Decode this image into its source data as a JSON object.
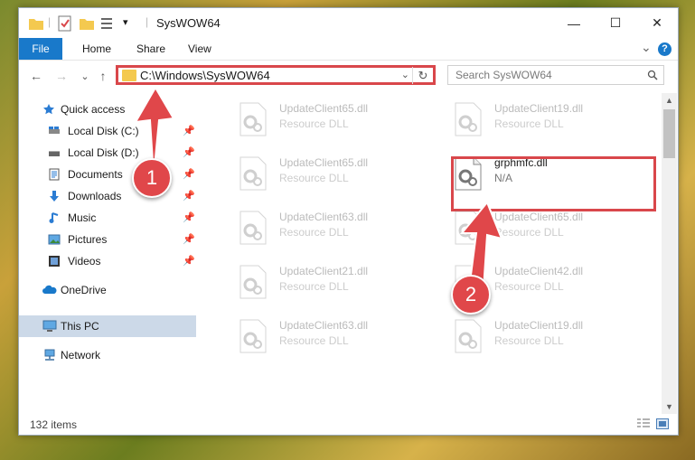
{
  "titlebar": {
    "title": "SysWOW64",
    "minimize_glyph": "—",
    "maximize_glyph": "☐",
    "close_glyph": "✕",
    "dropdown_glyph": "▾"
  },
  "ribbon": {
    "tabs": [
      "File",
      "Home",
      "Share",
      "View"
    ],
    "collapse_glyph": "⌄",
    "help_glyph": "?"
  },
  "address": {
    "back_glyph": "←",
    "forward_glyph": "→",
    "recent_glyph": "⌄",
    "up_glyph": "↑",
    "path": "C:\\Windows\\SysWOW64",
    "dropdown_glyph": "⌄",
    "refresh_glyph": "↻"
  },
  "search": {
    "placeholder": "Search SysWOW64"
  },
  "sidebar": {
    "items": [
      {
        "label": "Quick access",
        "icon": "star-icon",
        "pinned": false
      },
      {
        "label": "Local Disk (C:)",
        "icon": "drive-icon",
        "pinned": true
      },
      {
        "label": "Local Disk (D:)",
        "icon": "drive-icon",
        "pinned": true
      },
      {
        "label": "Documents",
        "icon": "documents-icon",
        "pinned": true
      },
      {
        "label": "Downloads",
        "icon": "download-icon",
        "pinned": true
      },
      {
        "label": "Music",
        "icon": "music-icon",
        "pinned": true
      },
      {
        "label": "Pictures",
        "icon": "pictures-icon",
        "pinned": true
      },
      {
        "label": "Videos",
        "icon": "videos-icon",
        "pinned": true
      },
      {
        "label": "OneDrive",
        "icon": "cloud-icon",
        "pinned": false
      },
      {
        "label": "This PC",
        "icon": "computer-icon",
        "pinned": false,
        "selected": true
      },
      {
        "label": "Network",
        "icon": "network-icon",
        "pinned": false
      }
    ],
    "pin_glyph": "📌"
  },
  "files": [
    {
      "name": "UpdateClient65.dll",
      "desc": "Resource DLL"
    },
    {
      "name": "UpdateClient19.dll",
      "desc": "Resource DLL"
    },
    {
      "name": "UpdateClient65.dll",
      "desc": "Resource DLL"
    },
    {
      "name": "grphmfc.dll",
      "desc": "N/A",
      "highlight": true
    },
    {
      "name": "UpdateClient63.dll",
      "desc": "Resource DLL"
    },
    {
      "name": "UpdateClient65.dll",
      "desc": "Resource DLL"
    },
    {
      "name": "UpdateClient21.dll",
      "desc": "Resource DLL"
    },
    {
      "name": "UpdateClient42.dll",
      "desc": "Resource DLL"
    },
    {
      "name": "UpdateClient63.dll",
      "desc": "Resource DLL"
    },
    {
      "name": "UpdateClient19.dll",
      "desc": "Resource DLL"
    }
  ],
  "scrollbar": {
    "up_glyph": "▲",
    "down_glyph": "▼"
  },
  "status": {
    "count": "132 items"
  },
  "annotations": {
    "step1": "1",
    "step2": "2"
  },
  "colors": {
    "accent": "#1979ca",
    "highlight": "#d9474b",
    "selected": "#ccd9e8"
  }
}
